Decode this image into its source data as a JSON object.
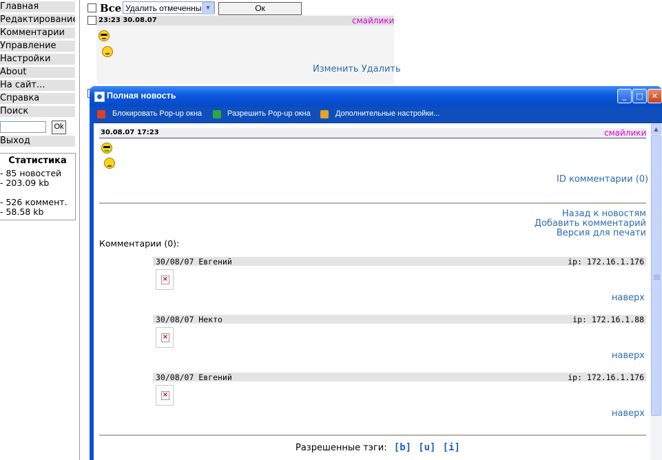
{
  "sidebar": {
    "items": [
      {
        "label": "Главная"
      },
      {
        "label": "Редактирование"
      },
      {
        "label": "Комментарии"
      },
      {
        "label": "Управление"
      },
      {
        "label": "Настройки"
      },
      {
        "label": "About"
      },
      {
        "label": "На сайт..."
      },
      {
        "label": "Справка"
      },
      {
        "label": "Поиск"
      }
    ],
    "search_ok": "Ok",
    "exit": "Выход"
  },
  "stats": {
    "title": "Статистика",
    "news_count": "- 85 новостей",
    "news_size": "- 203.09 kb",
    "comment_count": "- 526 коммент.",
    "comment_size": "- 58.58 kb"
  },
  "main": {
    "all_label": "Все",
    "action_select": "Удалить отмеченные",
    "ok_label": "Ок",
    "entry": {
      "date": "23:23 30.08.07",
      "smiles_link": "смайлики",
      "actions": "Изменить Удалить"
    }
  },
  "popup": {
    "title": "Полная новость",
    "toolbar": {
      "block": "Блокировать Pop-up окна",
      "allow": "Разрешить Pop-up окна",
      "settings": "Дополнительные настройки..."
    },
    "news": {
      "date": "30.08.07 17:23",
      "smiles_link": "смайлики",
      "id_comments": "ID  комментарии (0)"
    },
    "links": {
      "back": "Назад к новостям",
      "add_comment": "Добавить комментарий",
      "print": "Версия для печати"
    },
    "comments_title": "Комментарии (0):",
    "comments": [
      {
        "header": "30/08/07 Евгений",
        "ip": "ip: 172.16.1.176",
        "top": "наверх"
      },
      {
        "header": "30/08/07 Некто",
        "ip": "ip: 172.16.1.88",
        "top": "наверх"
      },
      {
        "header": "30/08/07 Евгений",
        "ip": "ip: 172.16.1.176",
        "top": "наверх"
      }
    ],
    "tags_label": "Разрешенные тэги:",
    "tags": [
      "[b]",
      "[u]",
      "[i]"
    ]
  },
  "colors": {
    "link": "#2a6cb0",
    "smiles": "#d700d7",
    "xp_blue": "#0a4fd6"
  }
}
